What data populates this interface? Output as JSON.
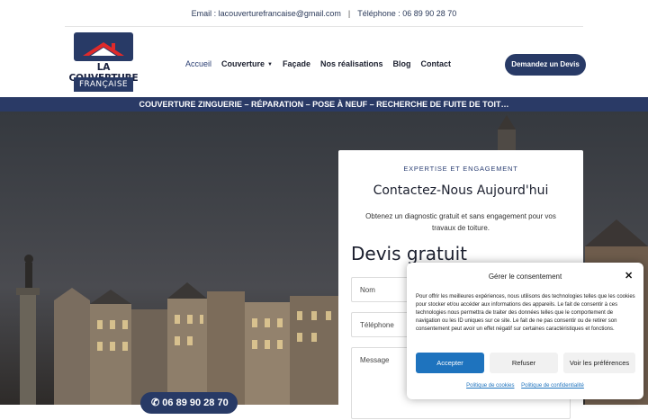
{
  "topbar": {
    "email": "Email : lacouverturefrancaise@gmail.com",
    "separator": "|",
    "phone": "Téléphone : 06 89 90 28 70"
  },
  "logo": {
    "line1": "LA COUVERTURE",
    "line2": "FRANÇAISE"
  },
  "nav": {
    "items": [
      {
        "label": "Accueil",
        "active": true
      },
      {
        "label": "Couverture",
        "dropdown": true
      },
      {
        "label": "Façade"
      },
      {
        "label": "Nos réalisations"
      },
      {
        "label": "Blog"
      },
      {
        "label": "Contact"
      }
    ],
    "cta": "Demandez un Devis"
  },
  "banner": "COUVERTURE ZINGUERIE – RÉPARATION – POSE À NEUF – RECHERCHE DE FUITE DE TOIT…",
  "hero": {
    "phone_partial": "06 89 90 28 70"
  },
  "contact_card": {
    "kicker": "EXPERTISE ET ENGAGEMENT",
    "heading": "Contactez-Nous Aujourd'hui",
    "description": "Obtenez un diagnostic gratuit et sans engagement pour vos travaux de toiture.",
    "form_title": "Devis gratuit",
    "fields": {
      "name_placeholder": "Nom",
      "phone_placeholder": "Téléphone",
      "message_placeholder": "Message"
    }
  },
  "consent": {
    "title": "Gérer le consentement",
    "body": "Pour offrir les meilleures expériences, nous utilisons des technologies telles que les cookies pour stocker et/ou accéder aux informations des appareils. Le fait de consentir à ces technologies nous permettra de traiter des données telles que le comportement de navigation ou les ID uniques sur ce site. Le fait de ne pas consentir ou de retirer son consentement peut avoir un effet négatif sur certaines caractéristiques et fonctions.",
    "accept": "Accepter",
    "refuse": "Refuser",
    "preferences": "Voir les préférences",
    "cookie_policy": "Politique de cookies",
    "privacy_policy": "Politique de confidentialité"
  },
  "colors": {
    "brand_navy": "#283a66",
    "banner_navy": "#2a3a66",
    "consent_accept": "#1e73be"
  },
  "icons": [
    "close-icon",
    "chevron-down-icon",
    "phone-icon"
  ]
}
